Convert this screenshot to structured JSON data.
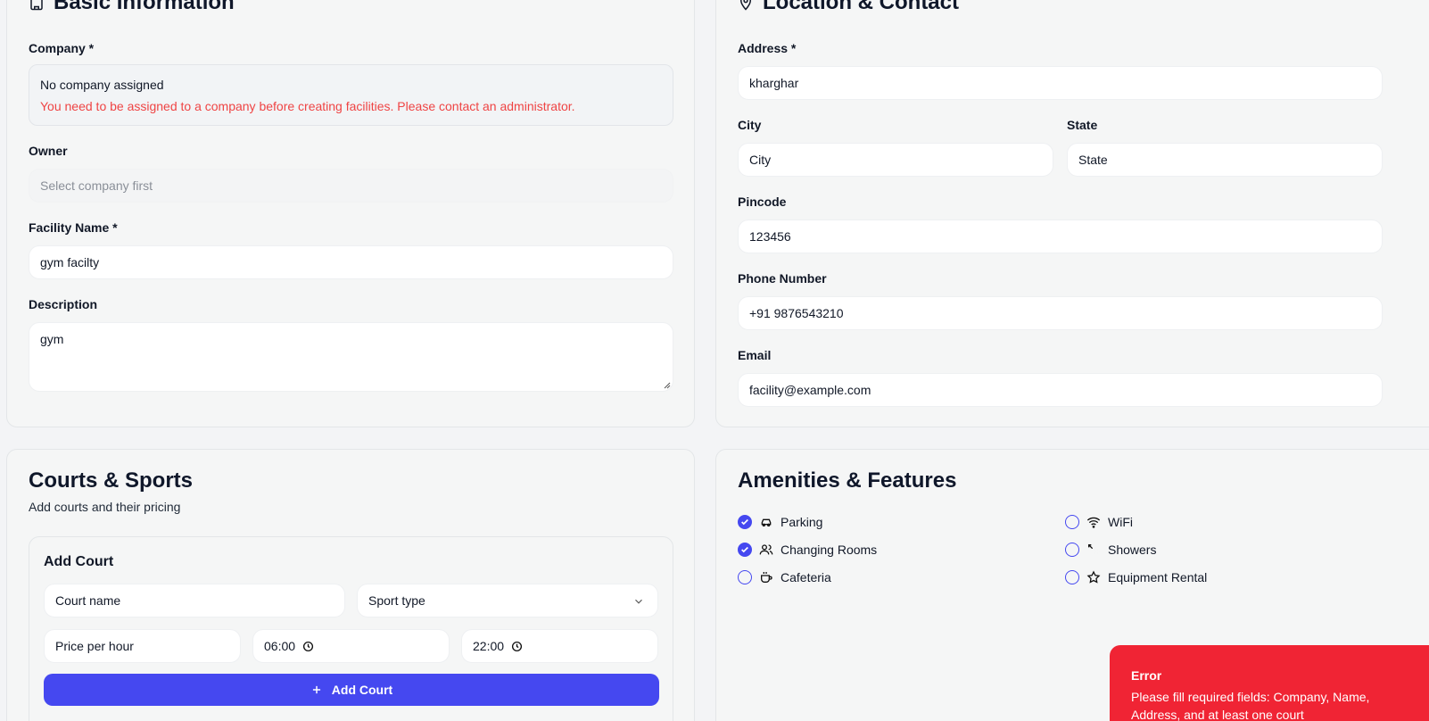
{
  "basic": {
    "title": "Basic Information",
    "company_label": "Company *",
    "company_value": "No company assigned",
    "company_error": "You need to be assigned to a company before creating facilities. Please contact an administrator.",
    "owner_label": "Owner",
    "owner_placeholder": "Select company first",
    "name_label": "Facility Name *",
    "name_value": "gym facilty",
    "desc_label": "Description",
    "desc_value": "gym"
  },
  "location": {
    "title": "Location & Contact",
    "address_label": "Address *",
    "address_value": "kharghar",
    "city_label": "City",
    "city_placeholder": "City",
    "state_label": "State",
    "state_placeholder": "State",
    "pincode_label": "Pincode",
    "pincode_placeholder": "123456",
    "phone_label": "Phone Number",
    "phone_placeholder": "+91 9876543210",
    "email_label": "Email",
    "email_placeholder": "facility@example.com"
  },
  "courts": {
    "title": "Courts & Sports",
    "subtitle": "Add courts and their pricing",
    "add_title": "Add Court",
    "court_name_placeholder": "Court name",
    "sport_type_placeholder": "Sport type",
    "price_placeholder": "Price per hour",
    "open_time": "06:00",
    "close_time": "22:00",
    "add_button": "Add Court"
  },
  "amenities": {
    "title": "Amenities & Features",
    "items": [
      {
        "label": "Parking",
        "checked": true,
        "icon": "car-icon"
      },
      {
        "label": "WiFi",
        "checked": false,
        "icon": "wifi-icon"
      },
      {
        "label": "Changing Rooms",
        "checked": true,
        "icon": "users-icon"
      },
      {
        "label": "Showers",
        "checked": false,
        "icon": "shower-icon"
      },
      {
        "label": "Cafeteria",
        "checked": false,
        "icon": "coffee-icon"
      },
      {
        "label": "Equipment Rental",
        "checked": false,
        "icon": "star-icon"
      }
    ]
  },
  "toast": {
    "title": "Error",
    "message": "Please fill required fields: Company, Name, Address, and at least one court"
  },
  "colors": {
    "accent": "#4548f0",
    "error": "#ef4444",
    "toast_bg": "#f02434"
  }
}
